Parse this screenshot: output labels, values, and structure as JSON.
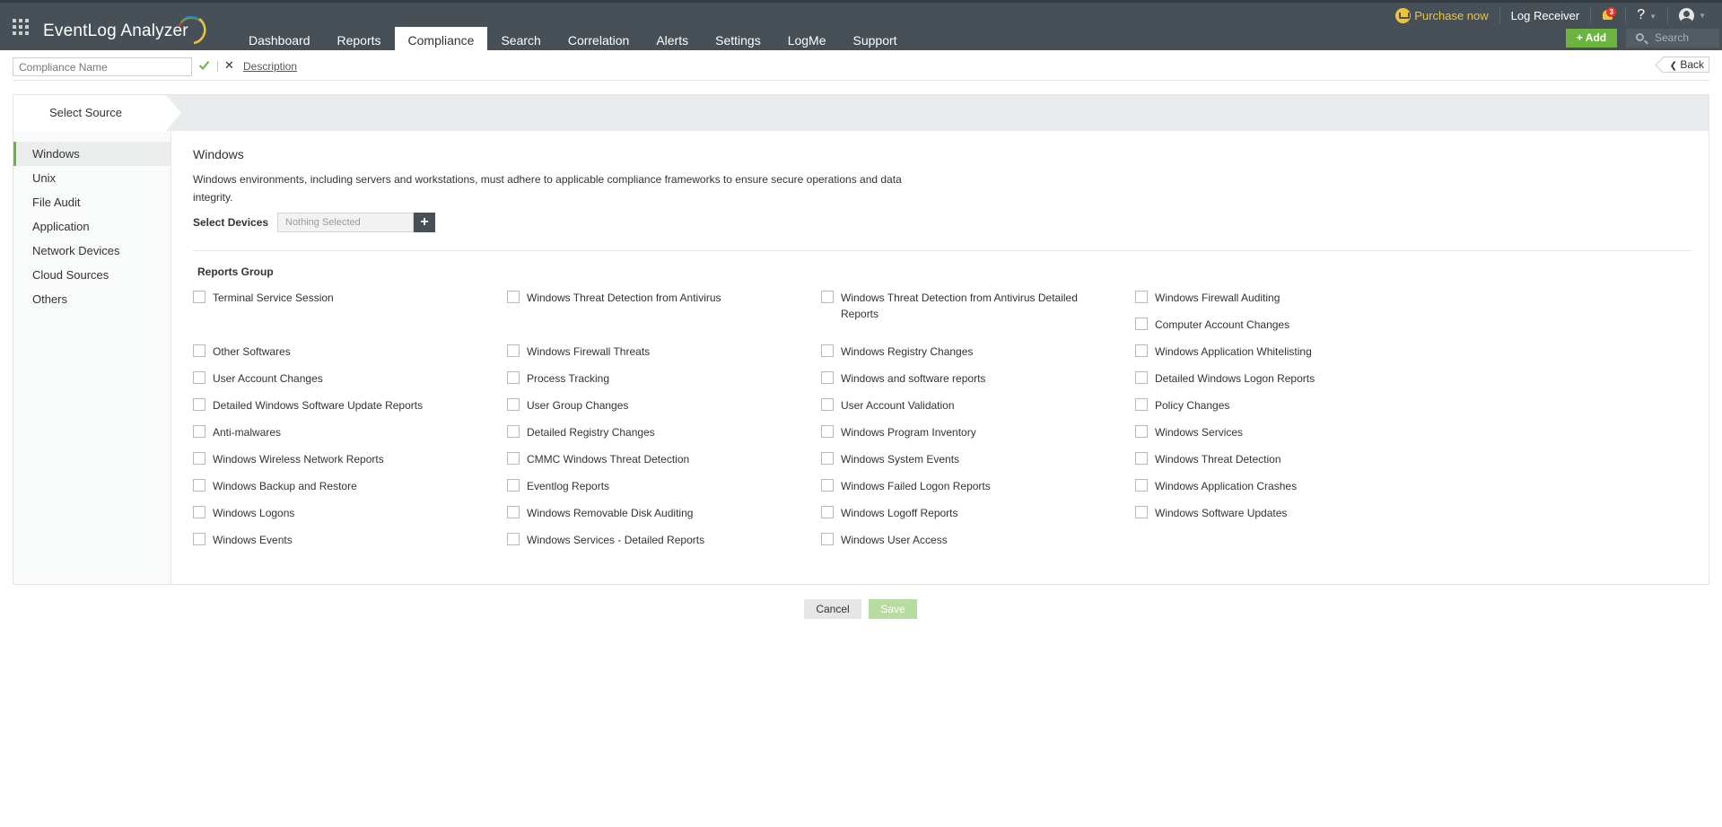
{
  "header": {
    "app_name": "EventLog Analyzer",
    "nav": [
      {
        "label": "Dashboard",
        "active": false
      },
      {
        "label": "Reports",
        "active": false
      },
      {
        "label": "Compliance",
        "active": true
      },
      {
        "label": "Search",
        "active": false
      },
      {
        "label": "Correlation",
        "active": false
      },
      {
        "label": "Alerts",
        "active": false
      },
      {
        "label": "Settings",
        "active": false
      },
      {
        "label": "LogMe",
        "active": false
      },
      {
        "label": "Support",
        "active": false
      }
    ],
    "purchase_label": "Purchase now",
    "log_receiver_label": "Log Receiver",
    "notification_count": "3",
    "help_label": "?",
    "add_label": "+ Add",
    "search_placeholder": "Search"
  },
  "namebar": {
    "name_placeholder": "Compliance Name",
    "name_value": "",
    "description_link": "Description",
    "back_label": "Back"
  },
  "wizard": {
    "active_step": "Select Source"
  },
  "sidebar": {
    "items": [
      {
        "label": "Windows",
        "active": true
      },
      {
        "label": "Unix",
        "active": false
      },
      {
        "label": "File Audit",
        "active": false
      },
      {
        "label": "Application",
        "active": false
      },
      {
        "label": "Network Devices",
        "active": false
      },
      {
        "label": "Cloud Sources",
        "active": false
      },
      {
        "label": "Others",
        "active": false
      }
    ]
  },
  "main": {
    "title": "Windows",
    "description": "Windows environments, including servers and workstations, must adhere to applicable compliance frameworks to ensure secure operations and data integrity.",
    "select_devices_label": "Select Devices",
    "select_devices_value": "Nothing Selected",
    "reports_group_title": "Reports Group",
    "report_columns": [
      [
        {
          "label": "Terminal Service Session",
          "checked": false
        },
        {
          "label": "Other Softwares",
          "checked": false
        },
        {
          "label": "User Account Changes",
          "checked": false
        },
        {
          "label": "Detailed Windows Software Update Reports",
          "checked": false
        },
        {
          "label": "Anti-malwares",
          "checked": false
        },
        {
          "label": "Windows Wireless Network Reports",
          "checked": false
        },
        {
          "label": "Windows Backup and Restore",
          "checked": false
        },
        {
          "label": "Windows Logons",
          "checked": false
        },
        {
          "label": "Windows Events",
          "checked": false
        }
      ],
      [
        {
          "label": "Windows Threat Detection from Antivirus",
          "checked": false
        },
        {
          "label": "Windows Firewall Threats",
          "checked": false
        },
        {
          "label": "Process Tracking",
          "checked": false
        },
        {
          "label": "User Group Changes",
          "checked": false
        },
        {
          "label": "Detailed Registry Changes",
          "checked": false
        },
        {
          "label": "CMMC Windows Threat Detection",
          "checked": false
        },
        {
          "label": "Eventlog Reports",
          "checked": false
        },
        {
          "label": "Windows Removable Disk Auditing",
          "checked": false
        },
        {
          "label": "Windows Services - Detailed Reports",
          "checked": false
        }
      ],
      [
        {
          "label": "Windows Threat Detection from Antivirus Detailed Reports",
          "checked": false
        },
        {
          "label": "Windows Registry Changes",
          "checked": false
        },
        {
          "label": "Windows and software reports",
          "checked": false
        },
        {
          "label": "User Account Validation",
          "checked": false
        },
        {
          "label": "Windows Program Inventory",
          "checked": false
        },
        {
          "label": "Windows System Events",
          "checked": false
        },
        {
          "label": "Windows Failed Logon Reports",
          "checked": false
        },
        {
          "label": "Windows Logoff Reports",
          "checked": false
        },
        {
          "label": "Windows User Access",
          "checked": false
        }
      ],
      [
        {
          "label": "Windows Firewall Auditing",
          "checked": false
        },
        {
          "label": "Computer Account Changes",
          "checked": false
        },
        {
          "label": "Windows Application Whitelisting",
          "checked": false
        },
        {
          "label": "Detailed Windows Logon Reports",
          "checked": false
        },
        {
          "label": "Policy Changes",
          "checked": false
        },
        {
          "label": "Windows Services",
          "checked": false
        },
        {
          "label": "Windows Threat Detection",
          "checked": false
        },
        {
          "label": "Windows Application Crashes",
          "checked": false
        },
        {
          "label": "Windows Software Updates",
          "checked": false
        }
      ]
    ]
  },
  "footer": {
    "cancel_label": "Cancel",
    "save_label": "Save"
  },
  "colors": {
    "header_bg": "#465056",
    "accent_green": "#6cb33f",
    "purchase_yellow": "#f0c339",
    "save_disabled": "#b7dca0"
  }
}
